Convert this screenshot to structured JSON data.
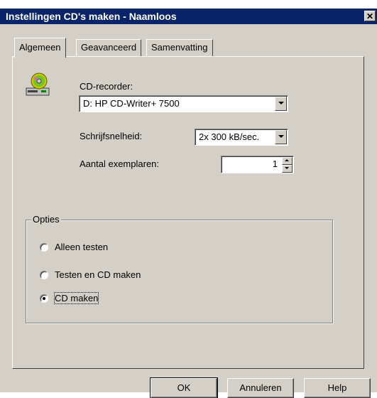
{
  "window": {
    "title": "Instellingen CD's maken - Naamloos",
    "close_glyph": "✕"
  },
  "tabs": [
    {
      "label": "Algemeen",
      "active": true
    },
    {
      "label": "Geavanceerd",
      "active": false
    },
    {
      "label": "Samenvatting",
      "active": false
    }
  ],
  "general": {
    "recorder_label": "CD-recorder:",
    "recorder_value": "D: HP CD-Writer+ 7500",
    "speed_label": "Schrijfsnelheid:",
    "speed_value": "2x 300 kB/sec.",
    "copies_label": "Aantal exemplaren:",
    "copies_value": "1"
  },
  "options": {
    "title": "Opties",
    "items": [
      {
        "label": "Alleen testen",
        "checked": false
      },
      {
        "label": "Testen en CD maken",
        "checked": false
      },
      {
        "label": "CD maken",
        "checked": true
      }
    ]
  },
  "buttons": {
    "ok": "OK",
    "cancel": "Annuleren",
    "help": "Help"
  },
  "icons": {
    "recorder": "cd-recorder-icon"
  }
}
